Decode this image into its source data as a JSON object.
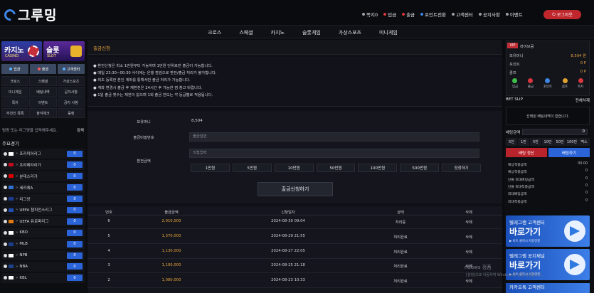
{
  "header": {
    "logo_text": "그루밍",
    "menu": [
      {
        "label": "쪽지0",
        "color": "#9aa0aa"
      },
      {
        "label": "입금",
        "color": "#d9373f"
      },
      {
        "label": "출금",
        "color": "#d9373f"
      },
      {
        "label": "포인트전환",
        "color": "#3d86e6"
      },
      {
        "label": "고객센터",
        "color": "#9aa0aa"
      },
      {
        "label": "공지사항",
        "color": "#9aa0aa"
      },
      {
        "label": "이벤트",
        "color": "#9aa0aa"
      }
    ],
    "logout_label": "로그아웃"
  },
  "nav": [
    "크로스",
    "스페셜",
    "카지노",
    "슬롯게임",
    "가상스포츠",
    "미니게임"
  ],
  "left": {
    "banners": [
      {
        "title": "카지노",
        "sub": "CASINO"
      },
      {
        "title": "슬롯",
        "sub": "SLOT"
      }
    ],
    "tabs": [
      {
        "label": "입금",
        "color": "#5bb0ff"
      },
      {
        "label": "출금",
        "color": "#ff5b5b"
      },
      {
        "label": "고객센터",
        "color": "#5bb0ff"
      }
    ],
    "grid": [
      "크로스",
      "스페셜",
      "가상스포츠",
      "미니게임",
      "배팅내역",
      "공지사항",
      "쪽지",
      "이벤트",
      "공지 사항",
      "추천인 목록",
      "출석체크",
      "룰렛"
    ],
    "search_placeholder": "팀명 또는 리그명을 입력해주세요.",
    "search_button": "검색",
    "featured_title": "주요경기",
    "leagues": [
      {
        "name": "프리미어리그",
        "count": "0",
        "flag": "#ffffff"
      },
      {
        "name": "프리메라리가",
        "count": "0",
        "flag": "#c60b1e"
      },
      {
        "name": "분데스리가",
        "count": "0",
        "flag": "#dd0000"
      },
      {
        "name": "세리에A",
        "count": "0",
        "flag": "#2e6fd1"
      },
      {
        "name": "리그앙",
        "count": "0",
        "flag": "#1c3d8f"
      },
      {
        "name": "UEFA 챔피언스리그",
        "count": "0",
        "flag": "#1f4fb2"
      },
      {
        "name": "UEFA 유로파리그",
        "count": "0",
        "flag": "#e07b12"
      },
      {
        "name": "KBO",
        "count": "0",
        "flag": "#ffffff"
      },
      {
        "name": "MLB",
        "count": "0",
        "flag": "#1a3e8c"
      },
      {
        "name": "NPB",
        "count": "0",
        "flag": "#ffffff"
      },
      {
        "name": "NBA",
        "count": "0",
        "flag": "#1d428a"
      },
      {
        "name": "KBL",
        "count": "0",
        "flag": "#ffffff"
      }
    ]
  },
  "main": {
    "title": "출금신청",
    "notices": [
      "● 환전신청은 최소 1만원부터 가능하며 1만원 단위로만 출금이 가능합니다.",
      "● 매일 23:30~00:30 사이에는 은행 점검으로 환전/출금 처리가 불가합니다.",
      "● 최초 등록한 본인 계좌를 통해서만 출금 처리가 가능합니다.",
      "● 계좌 변경시 출금 후 재환전은 24시간 후 가능한 점 참고 바랍니다.",
      "● 1일 출금 횟수는 제한이 없으며 1회 출금 한도는 각 등급별로 적용됩니다."
    ],
    "form": {
      "balance_label": "보유머니",
      "balance_value": "8,504",
      "password_label": "출금비밀번호",
      "password_placeholder": "출금암번",
      "amount_label": "환전금액",
      "amount_placeholder": "직접입력",
      "amount_buttons": [
        "1만원",
        "5만원",
        "10만원",
        "50만원",
        "100만원",
        "500만원",
        "정정하기"
      ],
      "submit_label": "출금신청하기"
    },
    "table": {
      "headers": [
        "번호",
        "출금금액",
        "신청일자",
        "상태",
        "삭제"
      ],
      "rows": [
        {
          "no": "6",
          "amount": "2,010,000",
          "date": "2024-08-30 09:04",
          "status": "처리중",
          "del": "삭제"
        },
        {
          "no": "5",
          "amount": "1,370,000",
          "date": "2024-08-29 21:55",
          "status": "처리완료",
          "del": "삭제"
        },
        {
          "no": "4",
          "amount": "1,130,000",
          "date": "2024-08-27 22:05",
          "status": "처리완료",
          "del": "삭제"
        },
        {
          "no": "3",
          "amount": "1,100,000",
          "date": "2024-08-25 21:18",
          "status": "처리완료",
          "del": "삭제"
        },
        {
          "no": "2",
          "amount": "1,080,000",
          "date": "2024-08-23 10:33",
          "status": "처리완료",
          "del": "삭제"
        }
      ]
    }
  },
  "right": {
    "badge": "VIP",
    "username": "라이브공",
    "rows": [
      {
        "label": "보유머니",
        "value": "8,504 원"
      },
      {
        "label": "포인트",
        "value": "0 P"
      },
      {
        "label": "콤프",
        "value": "0 P"
      }
    ],
    "icons": [
      {
        "label": "입금",
        "color": "#3fbf4a"
      },
      {
        "label": "출금",
        "color": "#d9373f"
      },
      {
        "label": "포인트",
        "color": "#3d86e6"
      },
      {
        "label": "콤프",
        "color": "#e0a22e"
      },
      {
        "label": "쪽지",
        "color": "#d9373f"
      }
    ],
    "betslip_title": "BET SLIP",
    "betslip_clear": "전체삭제",
    "betslip_empty": "선택된 배팅내역이 없습니다.",
    "bet_amount_label": "배팅금액",
    "bet_amount_value": "0",
    "chips": [
      "5천",
      "1만",
      "5만",
      "10만",
      "50만",
      "100만",
      "맥스"
    ],
    "reset_label": "배팅 정산",
    "bet_label": "배팅하기",
    "details": [
      {
        "label": "예상적중금액",
        "value": "00.00"
      },
      {
        "label": "예상적중금액",
        "value": "0"
      },
      {
        "label": "단폴 최대배팅금액",
        "value": "0"
      },
      {
        "label": "단폴 최대적중금액",
        "value": "0"
      },
      {
        "label": "최대배팅금액",
        "value": "0"
      },
      {
        "label": "최대적중금액",
        "value": "0"
      }
    ],
    "banners": [
      {
        "title": "텔레그램 고객센터",
        "big": "바로가기",
        "small": "▶ 비트 클릭시 자동연결"
      },
      {
        "title": "텔레그램 공지채널",
        "big": "바로가기",
        "small": "▶ 비트 클릭시 자동연결"
      }
    ],
    "kakao": "카카오톡 고객센터"
  },
  "watermark": {
    "line1": "ndows 정품",
    "line2": "[설정]으로 이동하여 Windows를 정품 인증합니다."
  }
}
